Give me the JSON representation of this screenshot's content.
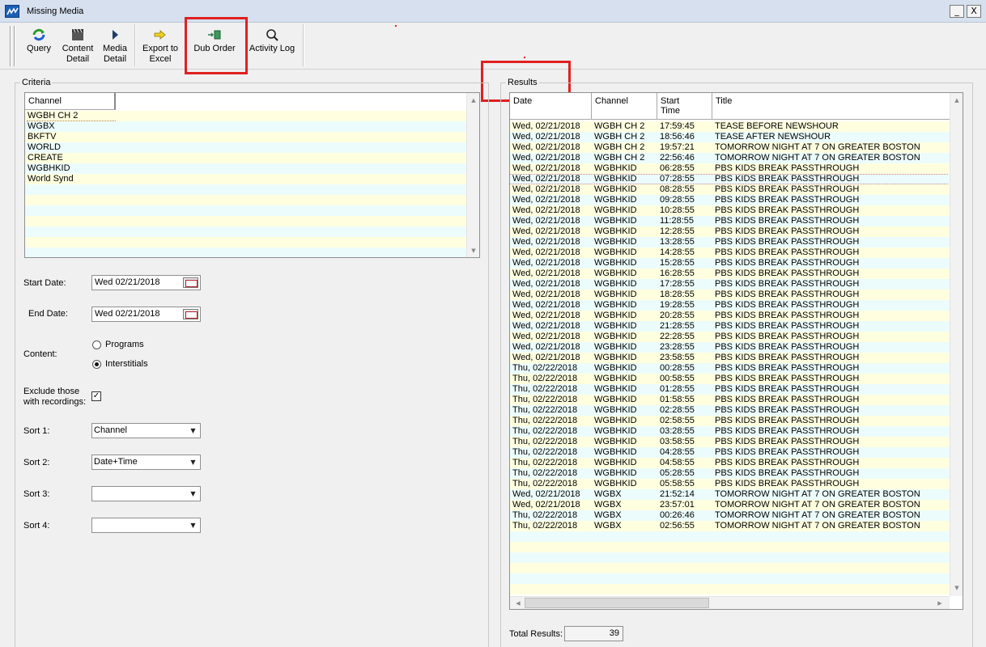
{
  "window": {
    "title": "Missing Media",
    "minimize": "_",
    "close": "X"
  },
  "toolbar": {
    "query": "Query",
    "content_detail": [
      "Content",
      "Detail"
    ],
    "media_detail": [
      "Media",
      "Detail"
    ],
    "export": [
      "Export to",
      "Excel"
    ],
    "dub_order": "Dub Order",
    "activity_log": "Activity Log"
  },
  "criteria": {
    "title": "Criteria",
    "channel_header": "Channel",
    "channels": [
      "WGBH CH 2",
      "WGBX",
      "BKFTV",
      "WORLD",
      "CREATE",
      "WGBHKID",
      "World Synd"
    ],
    "start_date_label": "Start Date:",
    "start_date": "Wed  02/21/2018",
    "end_date_label": "End Date:",
    "end_date": "Wed  02/21/2018",
    "content_label": "Content:",
    "programs": "Programs",
    "interstitials": "Interstitials",
    "exclude_label": [
      "Exclude those",
      "with recordings:"
    ],
    "exclude_checked": "✓",
    "sort1_label": "Sort 1:",
    "sort1": "Channel",
    "sort2_label": "Sort 2:",
    "sort2": "Date+Time",
    "sort3_label": "Sort 3:",
    "sort3": "",
    "sort4_label": "Sort 4:",
    "sort4": ""
  },
  "results": {
    "title": "Results",
    "headers": {
      "date": "Date",
      "channel": "Channel",
      "start": [
        "Start",
        "Time"
      ],
      "title": "Title"
    },
    "rows": [
      [
        "Wed, 02/21/2018",
        "WGBH CH 2",
        "17:59:45",
        "TEASE BEFORE NEWSHOUR"
      ],
      [
        "Wed, 02/21/2018",
        "WGBH CH 2",
        "18:56:46",
        "TEASE AFTER NEWSHOUR"
      ],
      [
        "Wed, 02/21/2018",
        "WGBH CH 2",
        "19:57:21",
        "TOMORROW NIGHT AT 7 ON GREATER BOSTON"
      ],
      [
        "Wed, 02/21/2018",
        "WGBH CH 2",
        "22:56:46",
        "TOMORROW NIGHT AT 7 ON GREATER BOSTON"
      ],
      [
        "Wed, 02/21/2018",
        "WGBHKID",
        "06:28:55",
        "PBS KIDS BREAK PASSTHROUGH"
      ],
      [
        "Wed, 02/21/2018",
        "WGBHKID",
        "07:28:55",
        "PBS KIDS BREAK PASSTHROUGH"
      ],
      [
        "Wed, 02/21/2018",
        "WGBHKID",
        "08:28:55",
        "PBS KIDS BREAK PASSTHROUGH"
      ],
      [
        "Wed, 02/21/2018",
        "WGBHKID",
        "09:28:55",
        "PBS KIDS BREAK PASSTHROUGH"
      ],
      [
        "Wed, 02/21/2018",
        "WGBHKID",
        "10:28:55",
        "PBS KIDS BREAK PASSTHROUGH"
      ],
      [
        "Wed, 02/21/2018",
        "WGBHKID",
        "11:28:55",
        "PBS KIDS BREAK PASSTHROUGH"
      ],
      [
        "Wed, 02/21/2018",
        "WGBHKID",
        "12:28:55",
        "PBS KIDS BREAK PASSTHROUGH"
      ],
      [
        "Wed, 02/21/2018",
        "WGBHKID",
        "13:28:55",
        "PBS KIDS BREAK PASSTHROUGH"
      ],
      [
        "Wed, 02/21/2018",
        "WGBHKID",
        "14:28:55",
        "PBS KIDS BREAK PASSTHROUGH"
      ],
      [
        "Wed, 02/21/2018",
        "WGBHKID",
        "15:28:55",
        "PBS KIDS BREAK PASSTHROUGH"
      ],
      [
        "Wed, 02/21/2018",
        "WGBHKID",
        "16:28:55",
        "PBS KIDS BREAK PASSTHROUGH"
      ],
      [
        "Wed, 02/21/2018",
        "WGBHKID",
        "17:28:55",
        "PBS KIDS BREAK PASSTHROUGH"
      ],
      [
        "Wed, 02/21/2018",
        "WGBHKID",
        "18:28:55",
        "PBS KIDS BREAK PASSTHROUGH"
      ],
      [
        "Wed, 02/21/2018",
        "WGBHKID",
        "19:28:55",
        "PBS KIDS BREAK PASSTHROUGH"
      ],
      [
        "Wed, 02/21/2018",
        "WGBHKID",
        "20:28:55",
        "PBS KIDS BREAK PASSTHROUGH"
      ],
      [
        "Wed, 02/21/2018",
        "WGBHKID",
        "21:28:55",
        "PBS KIDS BREAK PASSTHROUGH"
      ],
      [
        "Wed, 02/21/2018",
        "WGBHKID",
        "22:28:55",
        "PBS KIDS BREAK PASSTHROUGH"
      ],
      [
        "Wed, 02/21/2018",
        "WGBHKID",
        "23:28:55",
        "PBS KIDS BREAK PASSTHROUGH"
      ],
      [
        "Wed, 02/21/2018",
        "WGBHKID",
        "23:58:55",
        "PBS KIDS BREAK PASSTHROUGH"
      ],
      [
        "Thu, 02/22/2018",
        "WGBHKID",
        "00:28:55",
        "PBS KIDS BREAK PASSTHROUGH"
      ],
      [
        "Thu, 02/22/2018",
        "WGBHKID",
        "00:58:55",
        "PBS KIDS BREAK PASSTHROUGH"
      ],
      [
        "Thu, 02/22/2018",
        "WGBHKID",
        "01:28:55",
        "PBS KIDS BREAK PASSTHROUGH"
      ],
      [
        "Thu, 02/22/2018",
        "WGBHKID",
        "01:58:55",
        "PBS KIDS BREAK PASSTHROUGH"
      ],
      [
        "Thu, 02/22/2018",
        "WGBHKID",
        "02:28:55",
        "PBS KIDS BREAK PASSTHROUGH"
      ],
      [
        "Thu, 02/22/2018",
        "WGBHKID",
        "02:58:55",
        "PBS KIDS BREAK PASSTHROUGH"
      ],
      [
        "Thu, 02/22/2018",
        "WGBHKID",
        "03:28:55",
        "PBS KIDS BREAK PASSTHROUGH"
      ],
      [
        "Thu, 02/22/2018",
        "WGBHKID",
        "03:58:55",
        "PBS KIDS BREAK PASSTHROUGH"
      ],
      [
        "Thu, 02/22/2018",
        "WGBHKID",
        "04:28:55",
        "PBS KIDS BREAK PASSTHROUGH"
      ],
      [
        "Thu, 02/22/2018",
        "WGBHKID",
        "04:58:55",
        "PBS KIDS BREAK PASSTHROUGH"
      ],
      [
        "Thu, 02/22/2018",
        "WGBHKID",
        "05:28:55",
        "PBS KIDS BREAK PASSTHROUGH"
      ],
      [
        "Thu, 02/22/2018",
        "WGBHKID",
        "05:58:55",
        "PBS KIDS BREAK PASSTHROUGH"
      ],
      [
        "Wed, 02/21/2018",
        "WGBX",
        "21:52:14",
        "TOMORROW NIGHT AT 7 ON GREATER BOSTON"
      ],
      [
        "Wed, 02/21/2018",
        "WGBX",
        "23:57:01",
        "TOMORROW NIGHT AT 7 ON GREATER BOSTON"
      ],
      [
        "Thu, 02/22/2018",
        "WGBX",
        "00:26:46",
        "TOMORROW NIGHT AT 7 ON GREATER BOSTON"
      ],
      [
        "Thu, 02/22/2018",
        "WGBX",
        "02:56:55",
        "TOMORROW NIGHT AT 7 ON GREATER BOSTON"
      ]
    ],
    "total_label": "Total Results:",
    "total": "39"
  },
  "colors": {
    "row_yellow": "#ffffe0",
    "row_cyan": "#ecfcfc",
    "highlight": "#e02020",
    "titlebar": "#d6e0ef"
  }
}
